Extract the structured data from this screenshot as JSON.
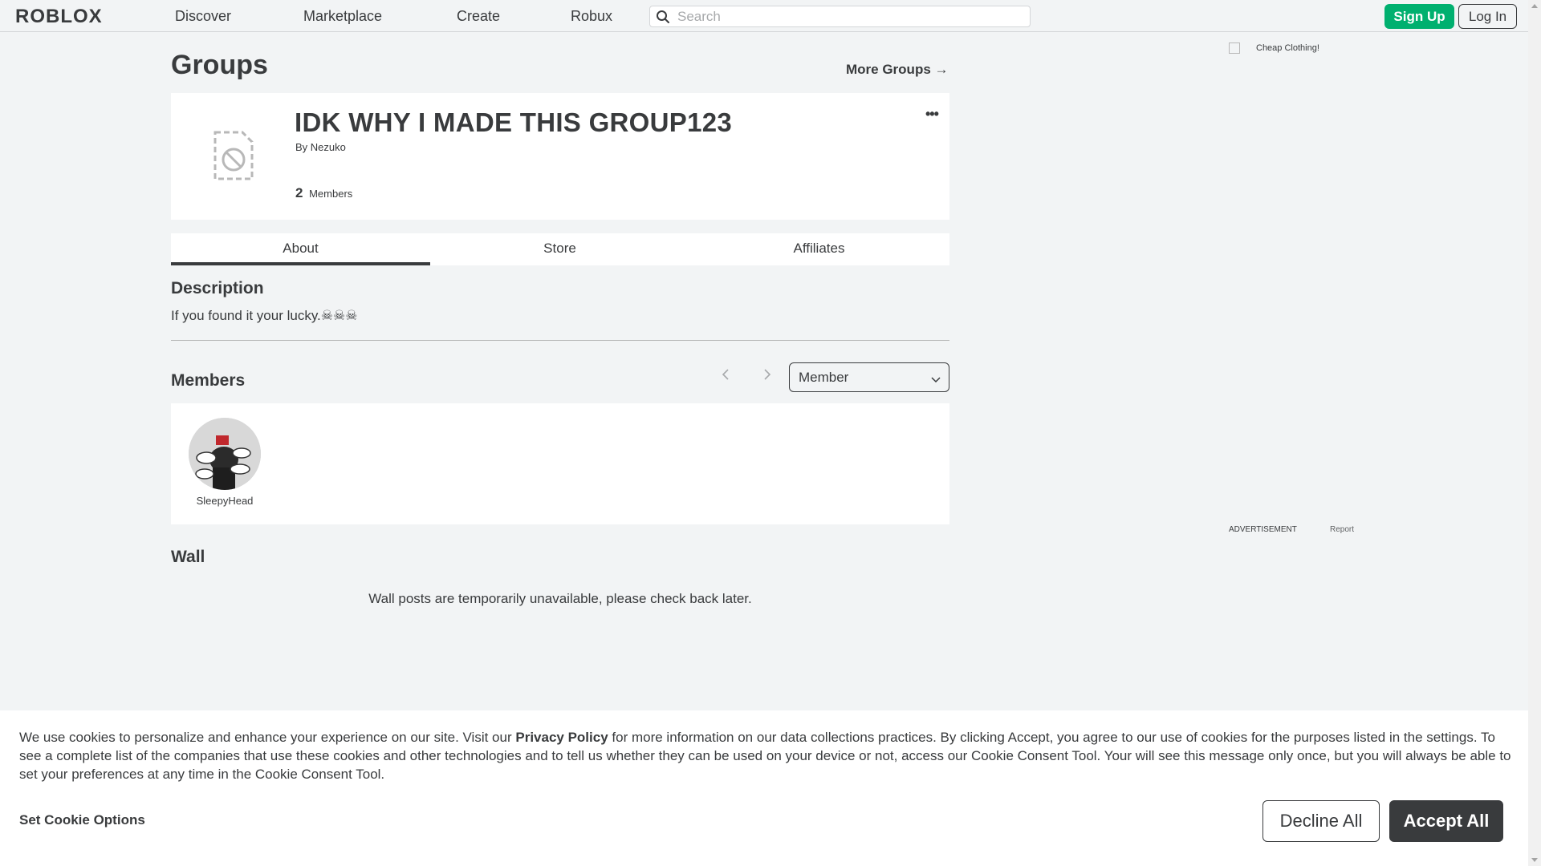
{
  "nav": {
    "logo": "ROBLOX",
    "links": [
      "Discover",
      "Marketplace",
      "Create",
      "Robux"
    ],
    "search_placeholder": "Search",
    "signup": "Sign Up",
    "login": "Log In"
  },
  "page": {
    "title": "Groups",
    "more_groups": "More Groups →"
  },
  "group": {
    "name": "IDK WHY I MADE THIS GROUP123",
    "by_prefix": "By",
    "owner": "Nezuko",
    "member_count": "2",
    "member_label": "Members",
    "more_menu": "•••"
  },
  "tabs": [
    "About",
    "Store",
    "Affiliates"
  ],
  "about": {
    "description_heading": "Description",
    "description": "If you found it your lucky.☠☠☠",
    "members_heading": "Members",
    "role_filter": "Member",
    "members": [
      {
        "name": "SleepyHead"
      }
    ],
    "wall_heading": "Wall",
    "wall_message": "Wall posts are temporarily unavailable, please check back later."
  },
  "ad": {
    "image_alt": "Cheap Clothing!",
    "label": "ADVERTISEMENT",
    "report": "Report"
  },
  "cookie": {
    "text_part1": "We use cookies to personalize and enhance your experience on our site. Visit our ",
    "privacy_link": "Privacy Policy",
    "text_part2": " for more information on our data collections practices. By clicking Accept, you agree to our use of cookies for the purposes listed in the settings. To see a complete list of the companies that use these cookies and other technologies and to tell us whether they can be used on your device or not, access our Cookie Consent Tool. Your will see this message only once, but you will always be able to set your preferences at any time in the Cookie Consent Tool.",
    "set_options": "Set Cookie Options",
    "decline": "Decline All",
    "accept": "Accept All"
  },
  "colors": {
    "signup_green": "#00b06f",
    "text_dark": "#393b3d",
    "page_bg": "#f2f4f5"
  }
}
